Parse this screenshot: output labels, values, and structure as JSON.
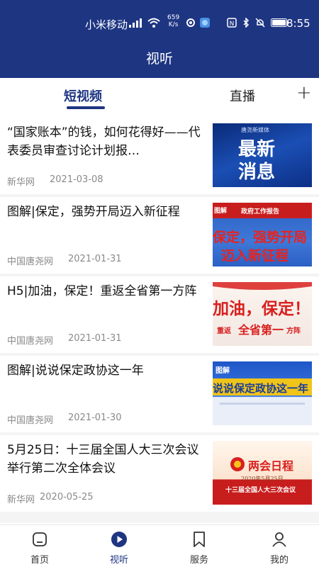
{
  "status_bar": {
    "carrier": "小米移动",
    "net_speed_value": "659",
    "net_speed_unit": "K/s",
    "time": "8:55"
  },
  "header": {
    "title": "视听"
  },
  "tabs": {
    "short_video": "短视频",
    "live": "直播",
    "add": "+"
  },
  "articles": [
    {
      "title": "“国家账本”的钱，如何花得好——代表委员审查讨论计划报…",
      "source": "新华网",
      "date": "2021-03-08",
      "thumb_text": [
        "唐尧新媒体",
        "最新",
        "消息"
      ]
    },
    {
      "title": "图解|保定，强势开局迈入新征程",
      "source": "中国唐尧网",
      "date": "2021-01-31",
      "thumb_text": [
        "图解",
        "政府工作报告",
        "保定，强势开局",
        "迈入新征程"
      ]
    },
    {
      "title": "H5|加油，保定！重返全省第一方阵",
      "source": "中国唐尧网",
      "date": "2021-01-31",
      "thumb_text": [
        "加油，保定！",
        "重返",
        "全省第一",
        "方阵"
      ]
    },
    {
      "title": "图解|说说保定政协这一年",
      "source": "中国唐尧网",
      "date": "2021-01-30",
      "thumb_text": [
        "图解",
        "说说保定政协这一年"
      ]
    },
    {
      "title": "5月25日：十三届全国人大三次会议举行第二次全体会议",
      "source": "新华网",
      "date": "2020-05-25",
      "thumb_text": [
        "两会日程",
        "2020年5月25日",
        "十三届全国人大三次会议"
      ]
    }
  ],
  "bottom_nav": [
    {
      "label": "首页",
      "icon": "home-icon"
    },
    {
      "label": "视听",
      "icon": "play-icon"
    },
    {
      "label": "服务",
      "icon": "bookmark-icon"
    },
    {
      "label": "我的",
      "icon": "person-icon"
    }
  ],
  "colors": {
    "brand": "#1e3582",
    "accent_red": "#d8201f"
  }
}
